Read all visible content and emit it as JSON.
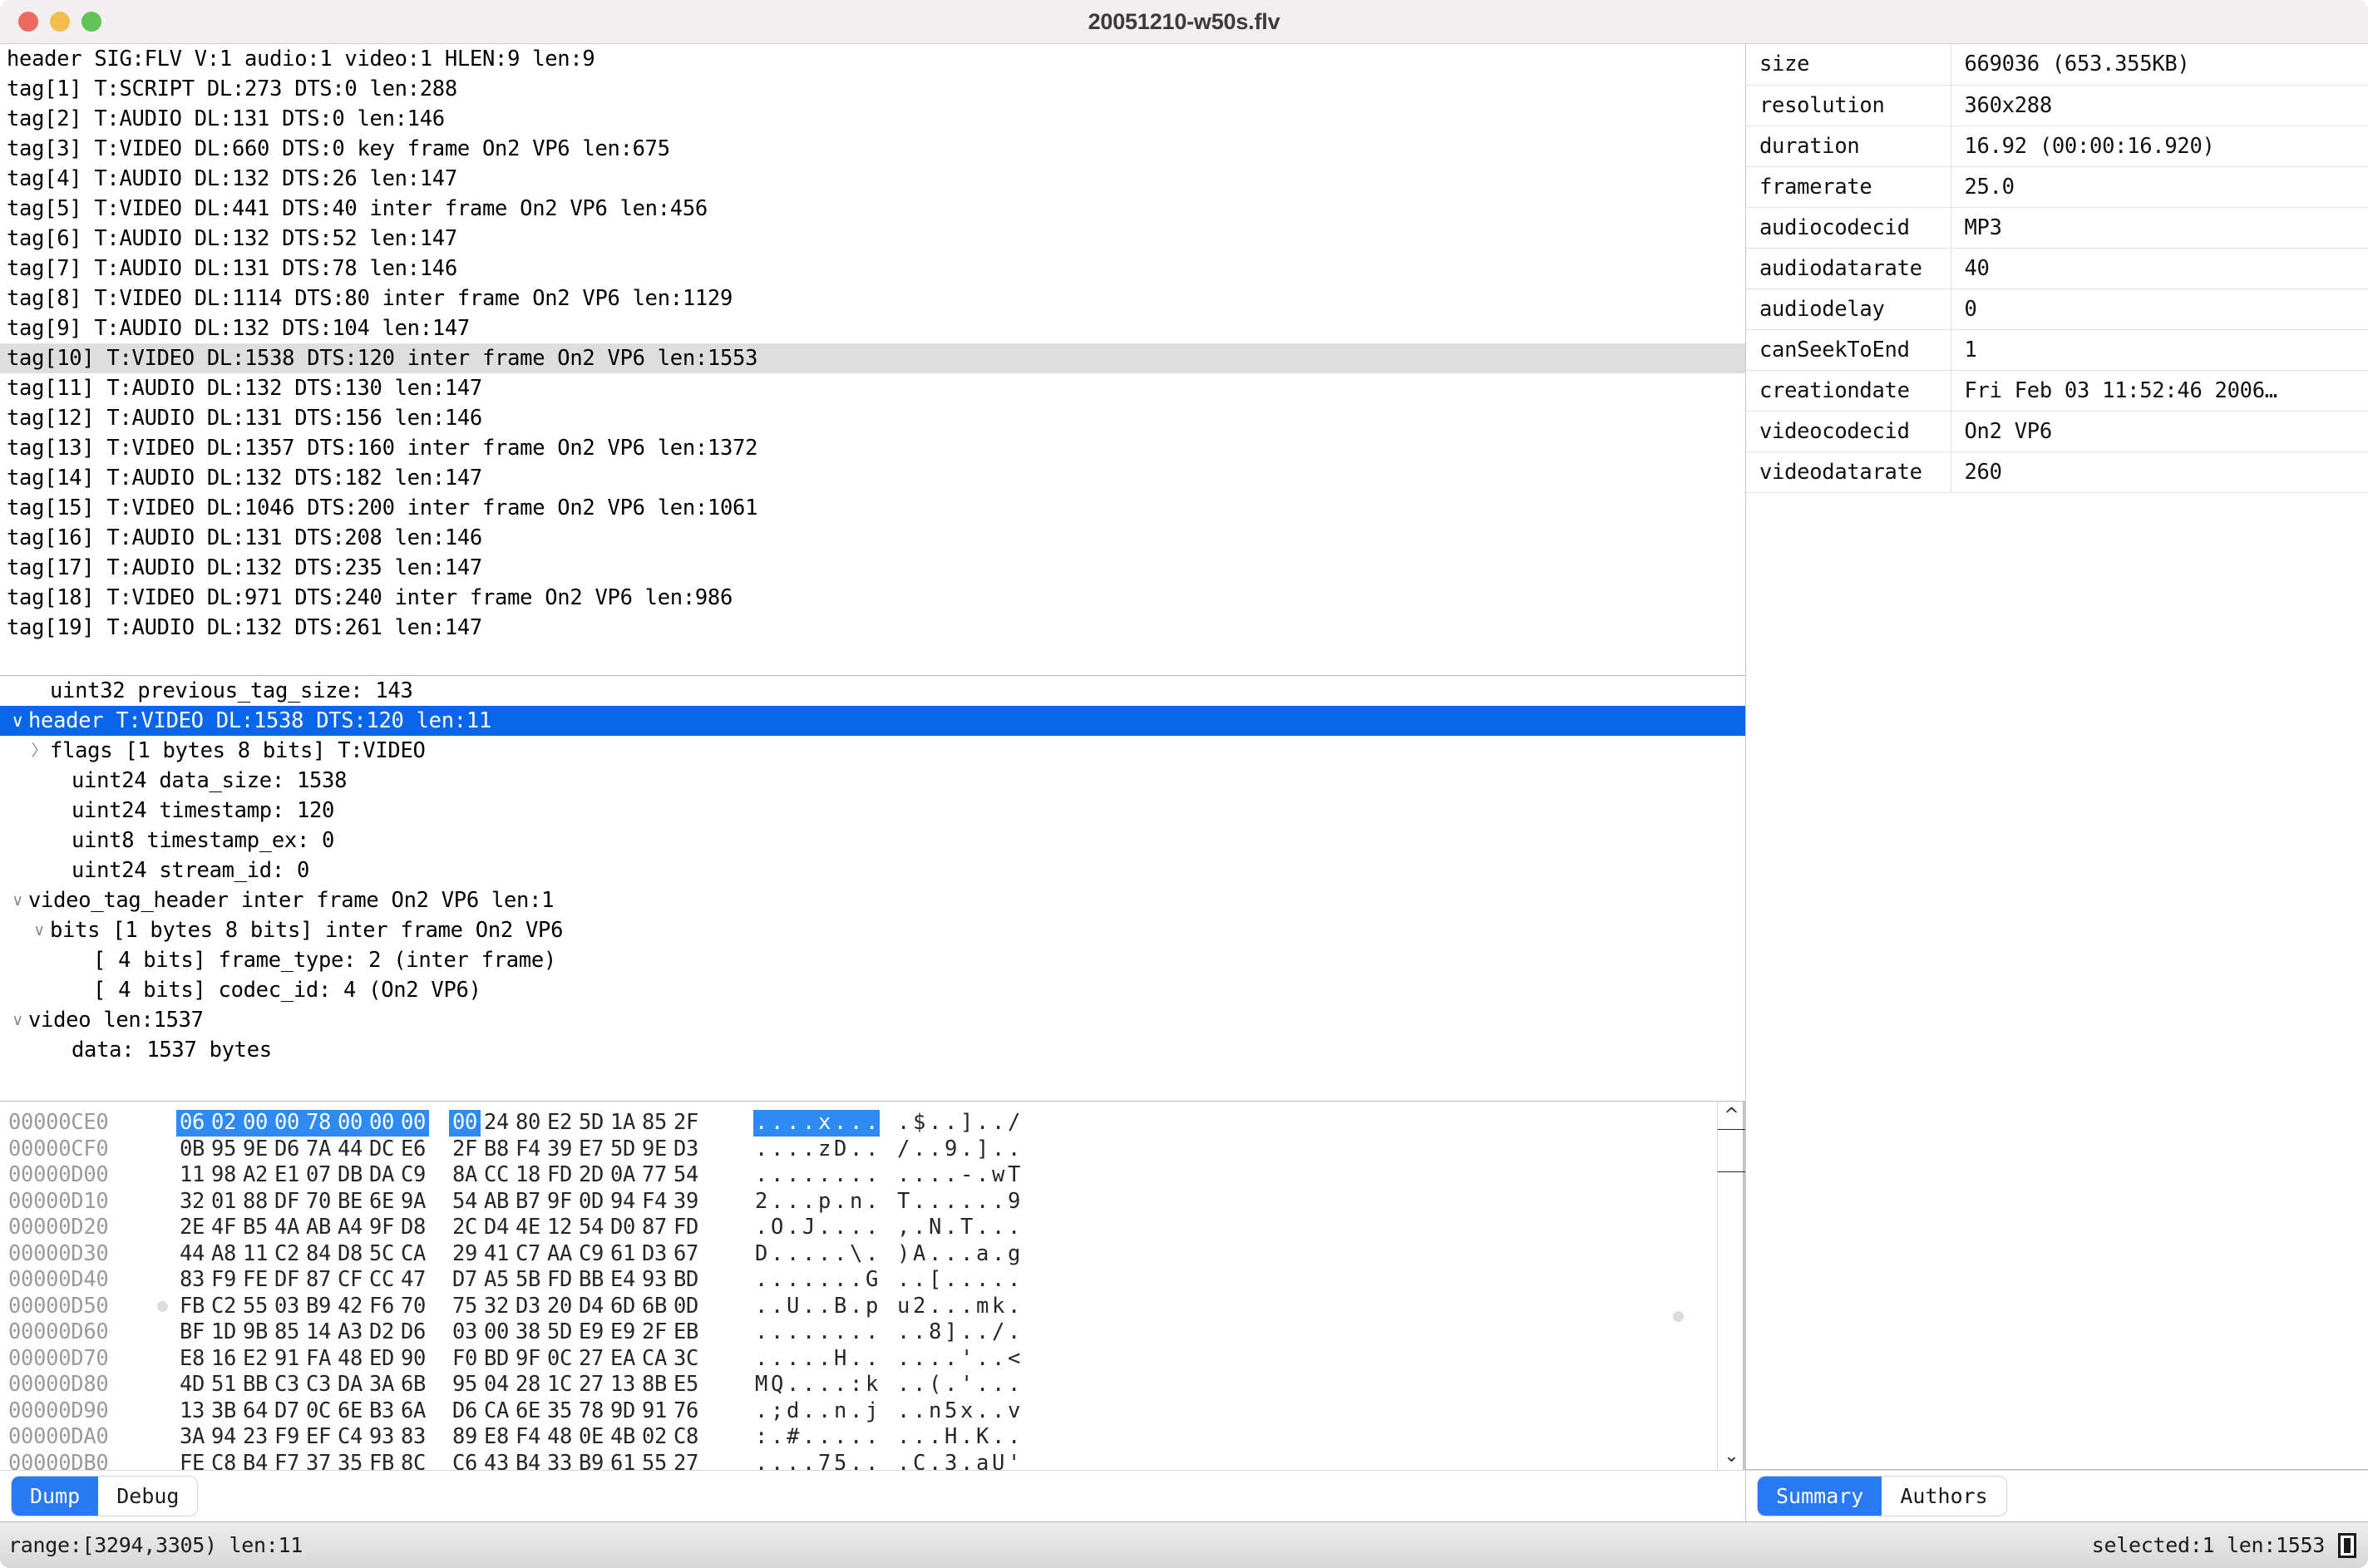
{
  "window": {
    "title": "20051210-w50s.flv",
    "traffic_lights": [
      "close-red",
      "minimize-yellow",
      "zoom-green"
    ]
  },
  "tag_list": {
    "rows": [
      {
        "text": "header SIG:FLV V:1 audio:1 video:1 HLEN:9 len:9",
        "state": "normal"
      },
      {
        "text": "tag[1] T:SCRIPT DL:273 DTS:0 len:288",
        "state": "normal"
      },
      {
        "text": "tag[2] T:AUDIO DL:131 DTS:0 len:146",
        "state": "normal"
      },
      {
        "text": "tag[3] T:VIDEO DL:660 DTS:0 key frame On2 VP6 len:675",
        "state": "normal"
      },
      {
        "text": "tag[4] T:AUDIO DL:132 DTS:26 len:147",
        "state": "normal"
      },
      {
        "text": "tag[5] T:VIDEO DL:441 DTS:40 inter frame On2 VP6 len:456",
        "state": "normal"
      },
      {
        "text": "tag[6] T:AUDIO DL:132 DTS:52 len:147",
        "state": "normal"
      },
      {
        "text": "tag[7] T:AUDIO DL:131 DTS:78 len:146",
        "state": "normal"
      },
      {
        "text": "tag[8] T:VIDEO DL:1114 DTS:80 inter frame On2 VP6 len:1129",
        "state": "normal"
      },
      {
        "text": "tag[9] T:AUDIO DL:132 DTS:104 len:147",
        "state": "normal"
      },
      {
        "text": "tag[10] T:VIDEO DL:1538 DTS:120 inter frame On2 VP6 len:1553",
        "state": "highlighted"
      },
      {
        "text": "tag[11] T:AUDIO DL:132 DTS:130 len:147",
        "state": "normal"
      },
      {
        "text": "tag[12] T:AUDIO DL:131 DTS:156 len:146",
        "state": "normal"
      },
      {
        "text": "tag[13] T:VIDEO DL:1357 DTS:160 inter frame On2 VP6 len:1372",
        "state": "normal"
      },
      {
        "text": "tag[14] T:AUDIO DL:132 DTS:182 len:147",
        "state": "normal"
      },
      {
        "text": "tag[15] T:VIDEO DL:1046 DTS:200 inter frame On2 VP6 len:1061",
        "state": "normal"
      },
      {
        "text": "tag[16] T:AUDIO DL:131 DTS:208 len:146",
        "state": "normal"
      },
      {
        "text": "tag[17] T:AUDIO DL:132 DTS:235 len:147",
        "state": "normal"
      },
      {
        "text": "tag[18] T:VIDEO DL:971 DTS:240 inter frame On2 VP6 len:986",
        "state": "normal"
      },
      {
        "text": "tag[19] T:AUDIO DL:132 DTS:261 len:147",
        "state": "normal"
      }
    ]
  },
  "detail_tree": {
    "rows": [
      {
        "text": "uint32 previous_tag_size: 143",
        "indent": 1,
        "chevron": "",
        "state": "normal"
      },
      {
        "text": "header T:VIDEO DL:1538 DTS:120 len:11",
        "indent": 0,
        "chevron": "expanded",
        "state": "selected"
      },
      {
        "text": "flags [1 bytes 8 bits] T:VIDEO",
        "indent": 1,
        "chevron": "collapsed",
        "state": "normal"
      },
      {
        "text": "uint24 data_size: 1538",
        "indent": 2,
        "chevron": "",
        "state": "normal"
      },
      {
        "text": "uint24 timestamp: 120",
        "indent": 2,
        "chevron": "",
        "state": "normal"
      },
      {
        "text": "uint8 timestamp_ex: 0",
        "indent": 2,
        "chevron": "",
        "state": "normal"
      },
      {
        "text": "uint24 stream_id: 0",
        "indent": 2,
        "chevron": "",
        "state": "normal"
      },
      {
        "text": "video_tag_header inter frame On2 VP6 len:1",
        "indent": 0,
        "chevron": "expanded",
        "state": "normal"
      },
      {
        "text": "bits [1 bytes 8 bits] inter frame On2 VP6",
        "indent": 1,
        "chevron": "expanded",
        "state": "normal"
      },
      {
        "text": "[ 4 bits] frame_type: 2 (inter frame)",
        "indent": 3,
        "chevron": "",
        "state": "normal"
      },
      {
        "text": "[ 4 bits] codec_id: 4 (On2 VP6)",
        "indent": 3,
        "chevron": "",
        "state": "normal"
      },
      {
        "text": "video len:1537",
        "indent": 0,
        "chevron": "expanded",
        "state": "normal"
      },
      {
        "text": "data: 1537 bytes",
        "indent": 2,
        "chevron": "",
        "state": "normal"
      }
    ]
  },
  "hex_dump": {
    "rows": [
      {
        "offset": "00000CE0",
        "marker": false,
        "bytes": [
          "06",
          "02",
          "00",
          "00",
          "78",
          "00",
          "00",
          "00",
          "00",
          "24",
          "80",
          "E2",
          "5D",
          "1A",
          "85",
          "2F"
        ],
        "ascii": [
          ".",
          ".",
          ".",
          ".",
          "x",
          ".",
          ".",
          ".",
          ".",
          "$",
          ".",
          ".",
          "]",
          ".",
          ".",
          "/"
        ],
        "sel_bytes": [
          0,
          1,
          2,
          3,
          4,
          5,
          6,
          7,
          8
        ],
        "sel_ascii": [
          0,
          1,
          2,
          3,
          4,
          5,
          6,
          7
        ]
      },
      {
        "offset": "00000CF0",
        "marker": false,
        "bytes": [
          "0B",
          "95",
          "9E",
          "D6",
          "7A",
          "44",
          "DC",
          "E6",
          "2F",
          "B8",
          "F4",
          "39",
          "E7",
          "5D",
          "9E",
          "D3"
        ],
        "ascii": [
          ".",
          ".",
          ".",
          ".",
          "z",
          "D",
          ".",
          ".",
          "/",
          ".",
          ".",
          "9",
          ".",
          "]",
          ".",
          "."
        ],
        "sel_bytes": [],
        "sel_ascii": []
      },
      {
        "offset": "00000D00",
        "marker": false,
        "bytes": [
          "11",
          "98",
          "A2",
          "E1",
          "07",
          "DB",
          "DA",
          "C9",
          "8A",
          "CC",
          "18",
          "FD",
          "2D",
          "0A",
          "77",
          "54"
        ],
        "ascii": [
          ".",
          ".",
          ".",
          ".",
          ".",
          ".",
          ".",
          ".",
          ".",
          ".",
          ".",
          ".",
          "-",
          ".",
          "w",
          "T"
        ],
        "sel_bytes": [],
        "sel_ascii": []
      },
      {
        "offset": "00000D10",
        "marker": false,
        "bytes": [
          "32",
          "01",
          "88",
          "DF",
          "70",
          "BE",
          "6E",
          "9A",
          "54",
          "AB",
          "B7",
          "9F",
          "0D",
          "94",
          "F4",
          "39"
        ],
        "ascii": [
          "2",
          ".",
          ".",
          ".",
          "p",
          ".",
          "n",
          ".",
          "T",
          ".",
          ".",
          ".",
          ".",
          ".",
          ".",
          "9"
        ],
        "sel_bytes": [],
        "sel_ascii": []
      },
      {
        "offset": "00000D20",
        "marker": false,
        "bytes": [
          "2E",
          "4F",
          "B5",
          "4A",
          "AB",
          "A4",
          "9F",
          "D8",
          "2C",
          "D4",
          "4E",
          "12",
          "54",
          "D0",
          "87",
          "FD"
        ],
        "ascii": [
          ".",
          "O",
          ".",
          "J",
          ".",
          ".",
          ".",
          ".",
          ",",
          ".",
          "N",
          ".",
          "T",
          ".",
          ".",
          "."
        ],
        "sel_bytes": [],
        "sel_ascii": []
      },
      {
        "offset": "00000D30",
        "marker": false,
        "bytes": [
          "44",
          "A8",
          "11",
          "C2",
          "84",
          "D8",
          "5C",
          "CA",
          "29",
          "41",
          "C7",
          "AA",
          "C9",
          "61",
          "D3",
          "67"
        ],
        "ascii": [
          "D",
          ".",
          ".",
          ".",
          ".",
          ".",
          "\\",
          ".",
          ")",
          "A",
          ".",
          ".",
          ".",
          "a",
          ".",
          "g"
        ],
        "sel_bytes": [],
        "sel_ascii": []
      },
      {
        "offset": "00000D40",
        "marker": false,
        "bytes": [
          "83",
          "F9",
          "FE",
          "DF",
          "87",
          "CF",
          "CC",
          "47",
          "D7",
          "A5",
          "5B",
          "FD",
          "BB",
          "E4",
          "93",
          "BD"
        ],
        "ascii": [
          ".",
          ".",
          ".",
          ".",
          ".",
          ".",
          ".",
          "G",
          ".",
          ".",
          "[",
          ".",
          ".",
          ".",
          ".",
          "."
        ],
        "sel_bytes": [],
        "sel_ascii": []
      },
      {
        "offset": "00000D50",
        "marker": true,
        "bytes": [
          "FB",
          "C2",
          "55",
          "03",
          "B9",
          "42",
          "F6",
          "70",
          "75",
          "32",
          "D3",
          "20",
          "D4",
          "6D",
          "6B",
          "0D"
        ],
        "ascii": [
          ".",
          ".",
          "U",
          ".",
          ".",
          "B",
          ".",
          "p",
          "u",
          "2",
          ".",
          ".",
          ".",
          "m",
          "k",
          "."
        ],
        "sel_bytes": [],
        "sel_ascii": []
      },
      {
        "offset": "00000D60",
        "marker": false,
        "bytes": [
          "BF",
          "1D",
          "9B",
          "85",
          "14",
          "A3",
          "D2",
          "D6",
          "03",
          "00",
          "38",
          "5D",
          "E9",
          "E9",
          "2F",
          "EB"
        ],
        "ascii": [
          ".",
          ".",
          ".",
          ".",
          ".",
          ".",
          ".",
          ".",
          ".",
          ".",
          "8",
          "]",
          ".",
          ".",
          "/",
          "."
        ],
        "sel_bytes": [],
        "sel_ascii": []
      },
      {
        "offset": "00000D70",
        "marker": false,
        "bytes": [
          "E8",
          "16",
          "E2",
          "91",
          "FA",
          "48",
          "ED",
          "90",
          "F0",
          "BD",
          "9F",
          "0C",
          "27",
          "EA",
          "CA",
          "3C"
        ],
        "ascii": [
          ".",
          ".",
          ".",
          ".",
          ".",
          "H",
          ".",
          ".",
          ".",
          ".",
          ".",
          ".",
          "'",
          ".",
          ".",
          "<"
        ],
        "sel_bytes": [],
        "sel_ascii": []
      },
      {
        "offset": "00000D80",
        "marker": false,
        "bytes": [
          "4D",
          "51",
          "BB",
          "C3",
          "C3",
          "DA",
          "3A",
          "6B",
          "95",
          "04",
          "28",
          "1C",
          "27",
          "13",
          "8B",
          "E5"
        ],
        "ascii": [
          "M",
          "Q",
          ".",
          ".",
          ".",
          ".",
          ":",
          "k",
          ".",
          ".",
          "(",
          ".",
          "'",
          ".",
          ".",
          "."
        ],
        "sel_bytes": [],
        "sel_ascii": []
      },
      {
        "offset": "00000D90",
        "marker": false,
        "bytes": [
          "13",
          "3B",
          "64",
          "D7",
          "0C",
          "6E",
          "B3",
          "6A",
          "D6",
          "CA",
          "6E",
          "35",
          "78",
          "9D",
          "91",
          "76"
        ],
        "ascii": [
          ".",
          ";",
          "d",
          ".",
          ".",
          "n",
          ".",
          "j",
          ".",
          ".",
          "n",
          "5",
          "x",
          ".",
          ".",
          "v"
        ],
        "sel_bytes": [],
        "sel_ascii": []
      },
      {
        "offset": "00000DA0",
        "marker": false,
        "bytes": [
          "3A",
          "94",
          "23",
          "F9",
          "EF",
          "C4",
          "93",
          "83",
          "89",
          "E8",
          "F4",
          "48",
          "0E",
          "4B",
          "02",
          "C8"
        ],
        "ascii": [
          ":",
          ".",
          "#",
          ".",
          ".",
          ".",
          ".",
          ".",
          ".",
          ".",
          ".",
          "H",
          ".",
          "K",
          ".",
          "."
        ],
        "sel_bytes": [],
        "sel_ascii": []
      },
      {
        "offset": "00000DB0",
        "marker": false,
        "bytes": [
          "FE",
          "C8",
          "B4",
          "F7",
          "37",
          "35",
          "FB",
          "8C",
          "C6",
          "43",
          "B4",
          "33",
          "B9",
          "61",
          "55",
          "27"
        ],
        "ascii": [
          ".",
          ".",
          ".",
          ".",
          "7",
          "5",
          ".",
          ".",
          ".",
          "C",
          ".",
          "3",
          ".",
          "a",
          "U",
          "'"
        ],
        "sel_bytes": [],
        "sel_ascii": []
      }
    ],
    "scroll_up_icon": "chevron-up-icon",
    "scroll_down_icon": "chevron-down-icon"
  },
  "left_tabs": {
    "items": [
      {
        "label": "Dump",
        "active": true
      },
      {
        "label": "Debug",
        "active": false
      }
    ]
  },
  "right_tabs": {
    "items": [
      {
        "label": "Summary",
        "active": true
      },
      {
        "label": "Authors",
        "active": false
      }
    ]
  },
  "metadata": {
    "rows": [
      {
        "key": "size",
        "value": "669036 (653.355KB)"
      },
      {
        "key": "resolution",
        "value": "360x288"
      },
      {
        "key": "duration",
        "value": "16.92 (00:00:16.920)"
      },
      {
        "key": "framerate",
        "value": "25.0"
      },
      {
        "key": "audiocodecid",
        "value": "MP3"
      },
      {
        "key": "audiodatarate",
        "value": "40"
      },
      {
        "key": "audiodelay",
        "value": "0"
      },
      {
        "key": "canSeekToEnd",
        "value": "1"
      },
      {
        "key": "creationdate",
        "value": "Fri Feb 03 11:52:46 2006…"
      },
      {
        "key": "videocodecid",
        "value": "On2 VP6"
      },
      {
        "key": "videodatarate",
        "value": "260"
      }
    ]
  },
  "status_bar": {
    "left": "range:[3294,3305) len:11",
    "right": "selected:1 len:1553",
    "grip_icon": "resize-grip-icon"
  },
  "colors": {
    "selection_blue": "#0a66e8",
    "hex_selection_blue": "#2e8bf5",
    "tab_active_blue": "#2979f2",
    "row_highlight_gray": "#dedede",
    "titlebar_bg": "#f3eef0"
  }
}
